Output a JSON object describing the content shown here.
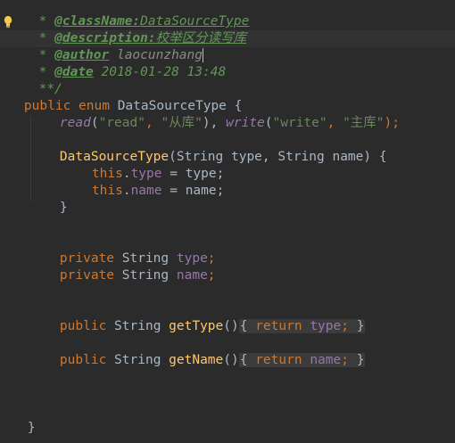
{
  "editor": {
    "lines": {
      "l1_prefix": " * ",
      "l1_tag": "@className:",
      "l1_value": "DataSourceType",
      "l2_prefix": " * ",
      "l2_tag": "@description:",
      "l2_value": "校举区分读写库",
      "l3_prefix": " * ",
      "l3_tag": "@author",
      "l3_value": " laocunzhang",
      "l4_prefix": " * ",
      "l4_tag": "@date",
      "l4_value": " 2018-01-28 13:48",
      "l5": " **/",
      "l6_kw1": "public",
      "l6_kw2": " enum",
      "l6_rest": " DataSourceType {",
      "l7_const1": "read",
      "l7_p1": "(",
      "l7_s1": "\"read\"",
      "l7_c1": ", ",
      "l7_s2": "\"从库\"",
      "l7_p2": "), ",
      "l7_const2": "write",
      "l7_p3": "(",
      "l7_s3": "\"write\"",
      "l7_c2": ", ",
      "l7_s4": "\"主库\"",
      "l7_p4": ");",
      "l9_name": "DataSourceType",
      "l9_rest": "(String type, String name) {",
      "l10_this": "this",
      "l10_dot": ".",
      "l10_field": "type",
      "l10_rest": " = type;",
      "l11_this": "this",
      "l11_dot": ".",
      "l11_field": "name",
      "l11_rest": " = name;",
      "l12": "}",
      "l15_kw": "private",
      "l15_type": " String ",
      "l15_field": "type",
      "l15_semi": ";",
      "l16_kw": "private",
      "l16_type": " String ",
      "l16_field": "name",
      "l16_semi": ";",
      "l19_kw": "public",
      "l19_type": " String ",
      "l19_method": "getType",
      "l19_paren": "()",
      "l19_fold_open": "{ ",
      "l19_ret": "return",
      "l19_space": " ",
      "l19_field": "type",
      "l19_semi": ";",
      "l19_fold_close": " }",
      "l21_kw": "public",
      "l21_type": " String ",
      "l21_method": "getName",
      "l21_paren": "()",
      "l21_fold_open": "{ ",
      "l21_ret": "return",
      "l21_space": " ",
      "l21_field": "name",
      "l21_semi": ";",
      "l21_fold_close": " }",
      "l25": "}"
    }
  },
  "icons": {
    "intention": "lightbulb-icon"
  },
  "colors": {
    "background": "#2b2b2b",
    "keyword": "#cc7832",
    "string": "#6a8759",
    "field": "#9876aa",
    "method": "#ffc66d",
    "doc": "#629755",
    "plain": "#a9b7c6"
  }
}
